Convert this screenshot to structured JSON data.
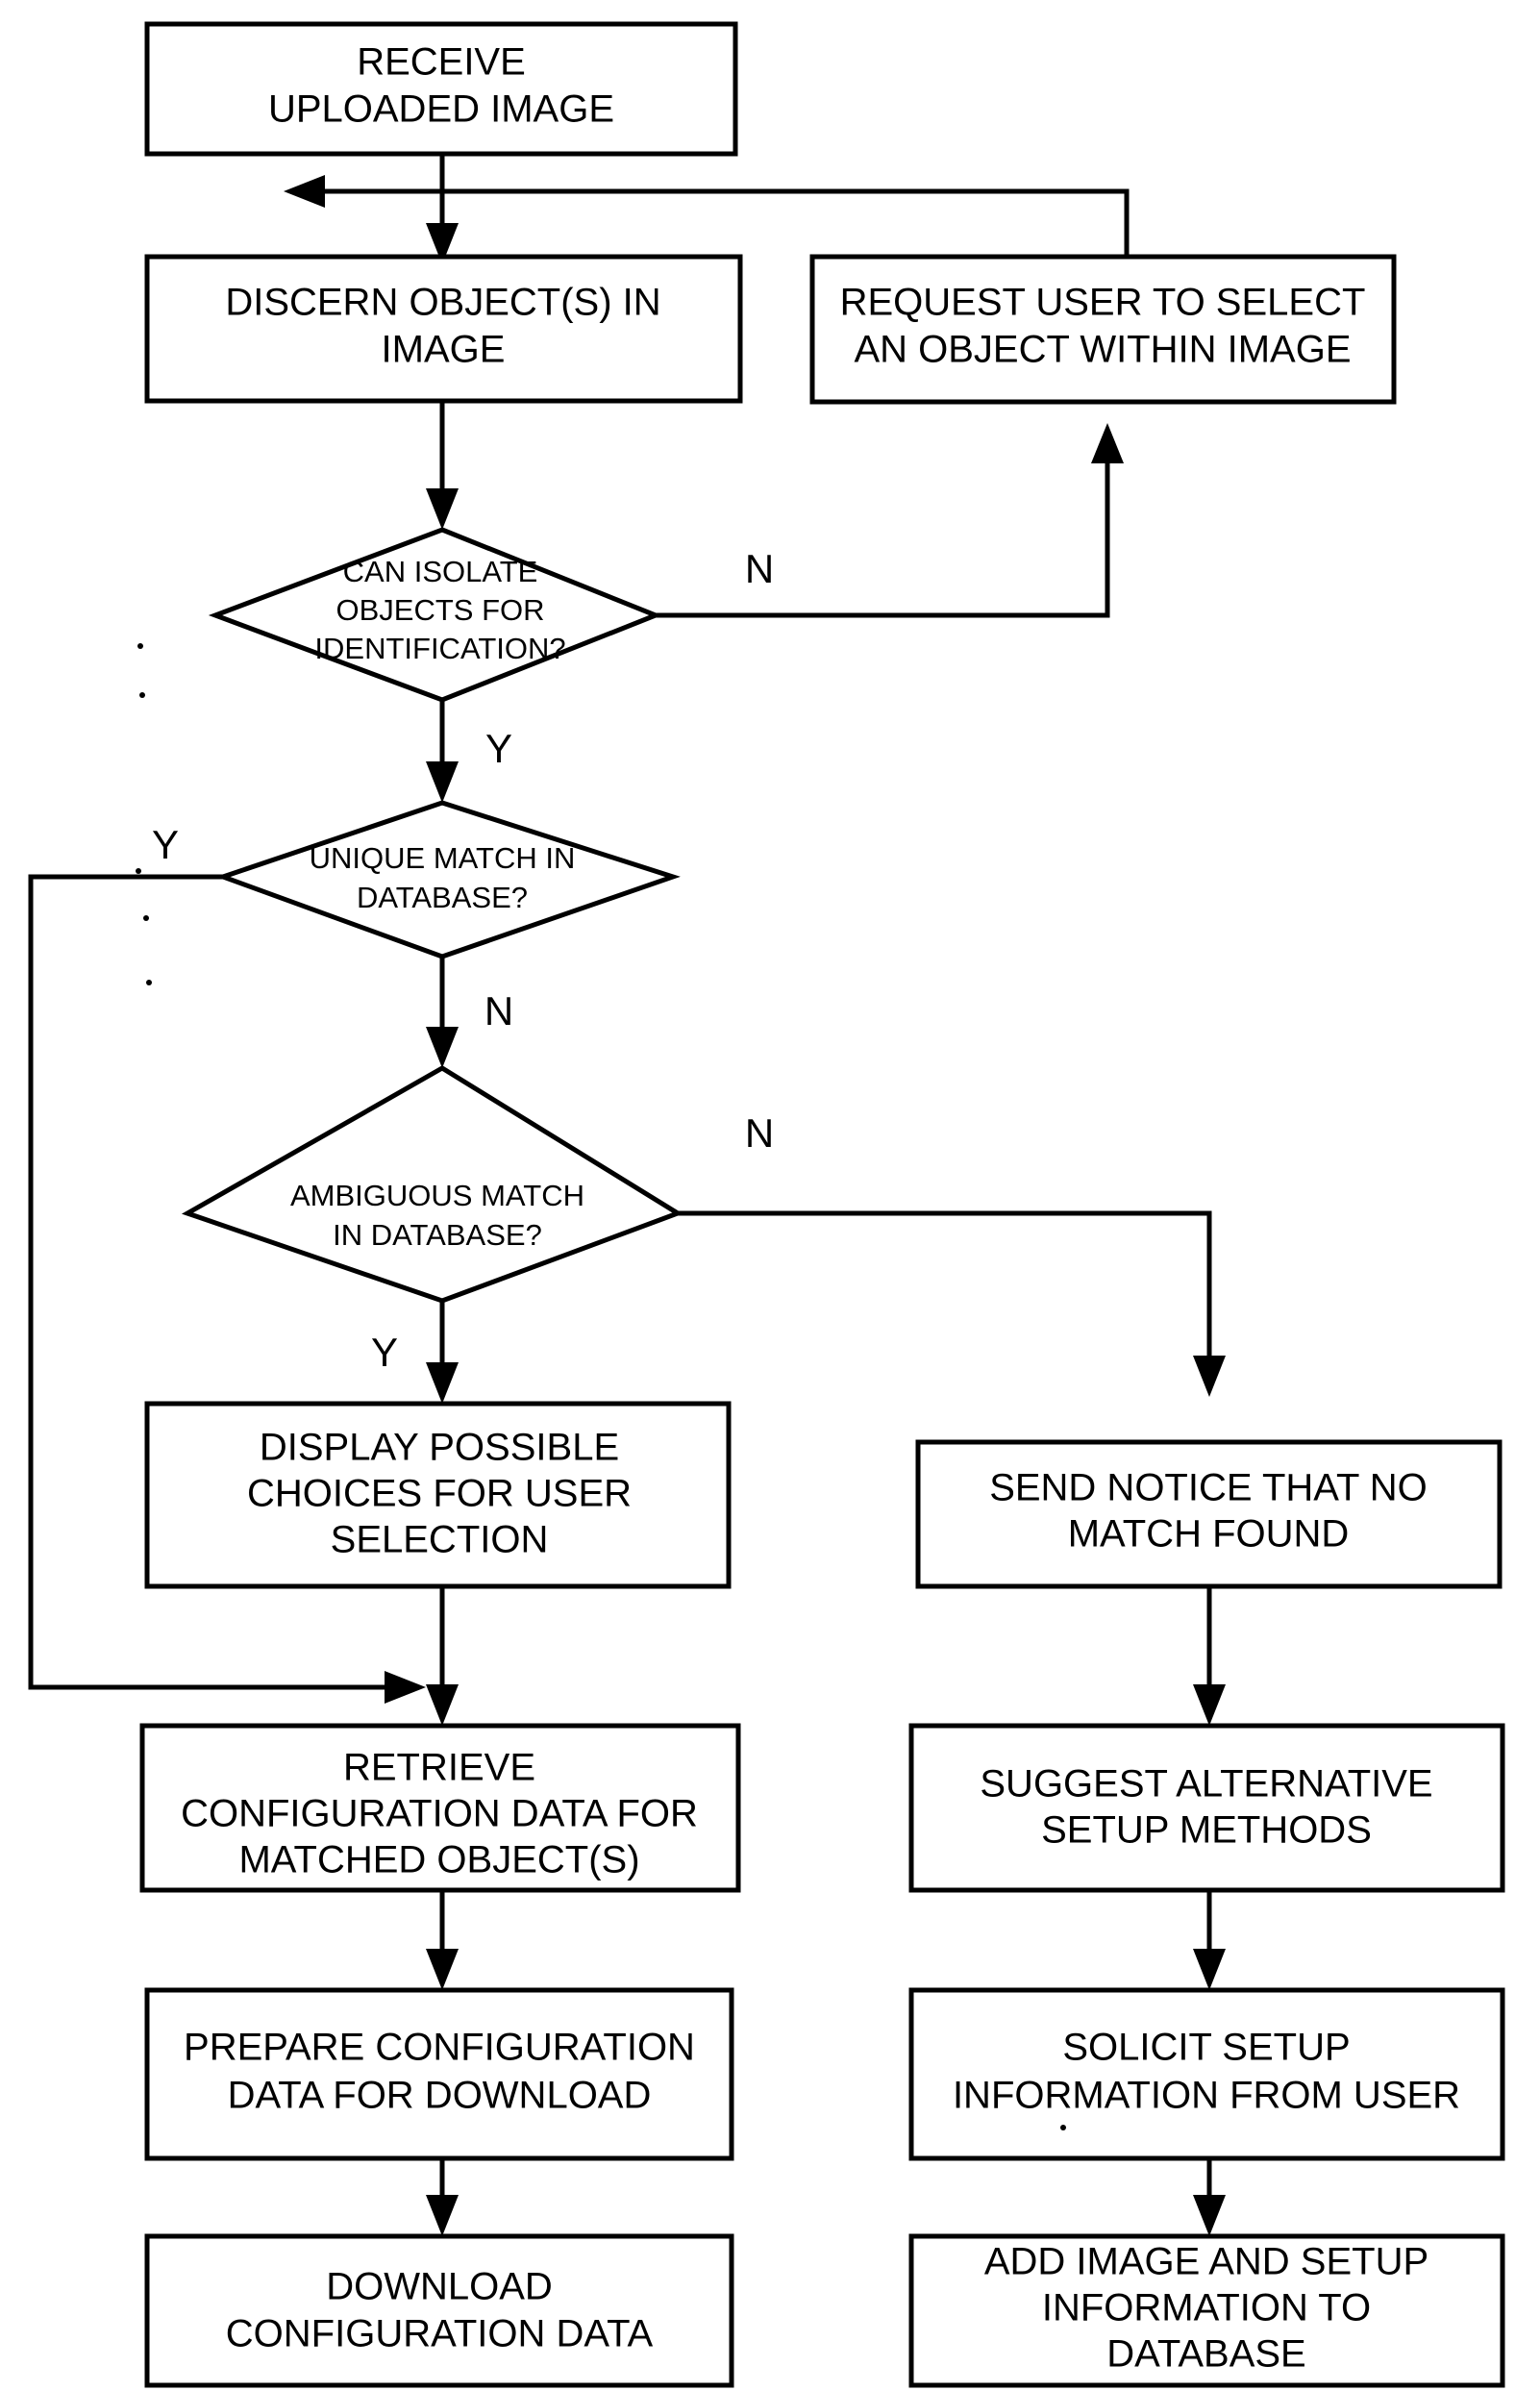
{
  "diagram": {
    "type": "flowchart",
    "title": "Image-based object identification and configuration flow",
    "orientation": "top-to-bottom",
    "nodes": [
      {
        "id": "receive",
        "shape": "process",
        "lines": [
          "RECEIVE",
          "UPLOADED IMAGE"
        ]
      },
      {
        "id": "discern",
        "shape": "process",
        "lines": [
          "DISCERN OBJECT(S) IN",
          "IMAGE"
        ]
      },
      {
        "id": "request_user",
        "shape": "process",
        "lines": [
          "REQUEST USER TO SELECT",
          "AN OBJECT WITHIN IMAGE"
        ]
      },
      {
        "id": "can_isolate",
        "shape": "decision",
        "lines": [
          "CAN ISOLATE",
          "OBJECTS FOR",
          "IDENTIFICATION?"
        ]
      },
      {
        "id": "unique_match",
        "shape": "decision",
        "lines": [
          "UNIQUE MATCH IN",
          "DATABASE?"
        ]
      },
      {
        "id": "ambiguous_match",
        "shape": "decision",
        "lines": [
          "AMBIGUOUS MATCH",
          "IN DATABASE?"
        ]
      },
      {
        "id": "display_choices",
        "shape": "process",
        "lines": [
          "DISPLAY POSSIBLE",
          "CHOICES FOR USER",
          "SELECTION"
        ]
      },
      {
        "id": "send_notice",
        "shape": "process",
        "lines": [
          "SEND NOTICE THAT NO",
          "MATCH FOUND"
        ]
      },
      {
        "id": "retrieve_config",
        "shape": "process",
        "lines": [
          "RETRIEVE",
          "CONFIGURATION DATA FOR",
          "MATCHED OBJECT(S)"
        ]
      },
      {
        "id": "suggest_alt",
        "shape": "process",
        "lines": [
          "SUGGEST ALTERNATIVE",
          "SETUP METHODS"
        ]
      },
      {
        "id": "prepare_config",
        "shape": "process",
        "lines": [
          "PREPARE CONFIGURATION",
          "DATA FOR DOWNLOAD"
        ]
      },
      {
        "id": "solicit_setup",
        "shape": "process",
        "lines": [
          "SOLICIT SETUP",
          "INFORMATION FROM USER"
        ]
      },
      {
        "id": "download_config",
        "shape": "process",
        "lines": [
          "DOWNLOAD",
          "CONFIGURATION DATA"
        ]
      },
      {
        "id": "add_image",
        "shape": "process",
        "lines": [
          "ADD IMAGE AND SETUP",
          "INFORMATION TO",
          "DATABASE"
        ]
      }
    ],
    "branch_labels": {
      "isolate_no": "N",
      "isolate_yes": "Y",
      "unique_yes": "Y",
      "unique_no": "N",
      "ambiguous_no": "N",
      "ambiguous_yes": "Y"
    },
    "edges": [
      {
        "from": "receive",
        "to": "discern",
        "label": ""
      },
      {
        "from": "discern",
        "to": "can_isolate",
        "label": ""
      },
      {
        "from": "can_isolate",
        "to": "request_user",
        "label": "N"
      },
      {
        "from": "request_user",
        "to": "discern",
        "label": ""
      },
      {
        "from": "can_isolate",
        "to": "unique_match",
        "label": "Y"
      },
      {
        "from": "unique_match",
        "to": "retrieve_config",
        "label": "Y"
      },
      {
        "from": "unique_match",
        "to": "ambiguous_match",
        "label": "N"
      },
      {
        "from": "ambiguous_match",
        "to": "display_choices",
        "label": "Y"
      },
      {
        "from": "ambiguous_match",
        "to": "send_notice",
        "label": "N"
      },
      {
        "from": "display_choices",
        "to": "retrieve_config",
        "label": ""
      },
      {
        "from": "retrieve_config",
        "to": "prepare_config",
        "label": ""
      },
      {
        "from": "prepare_config",
        "to": "download_config",
        "label": ""
      },
      {
        "from": "send_notice",
        "to": "suggest_alt",
        "label": ""
      },
      {
        "from": "suggest_alt",
        "to": "solicit_setup",
        "label": ""
      },
      {
        "from": "solicit_setup",
        "to": "add_image",
        "label": ""
      }
    ],
    "colors": {
      "stroke": "#000000",
      "fill": "#ffffff",
      "text": "#000000"
    }
  }
}
